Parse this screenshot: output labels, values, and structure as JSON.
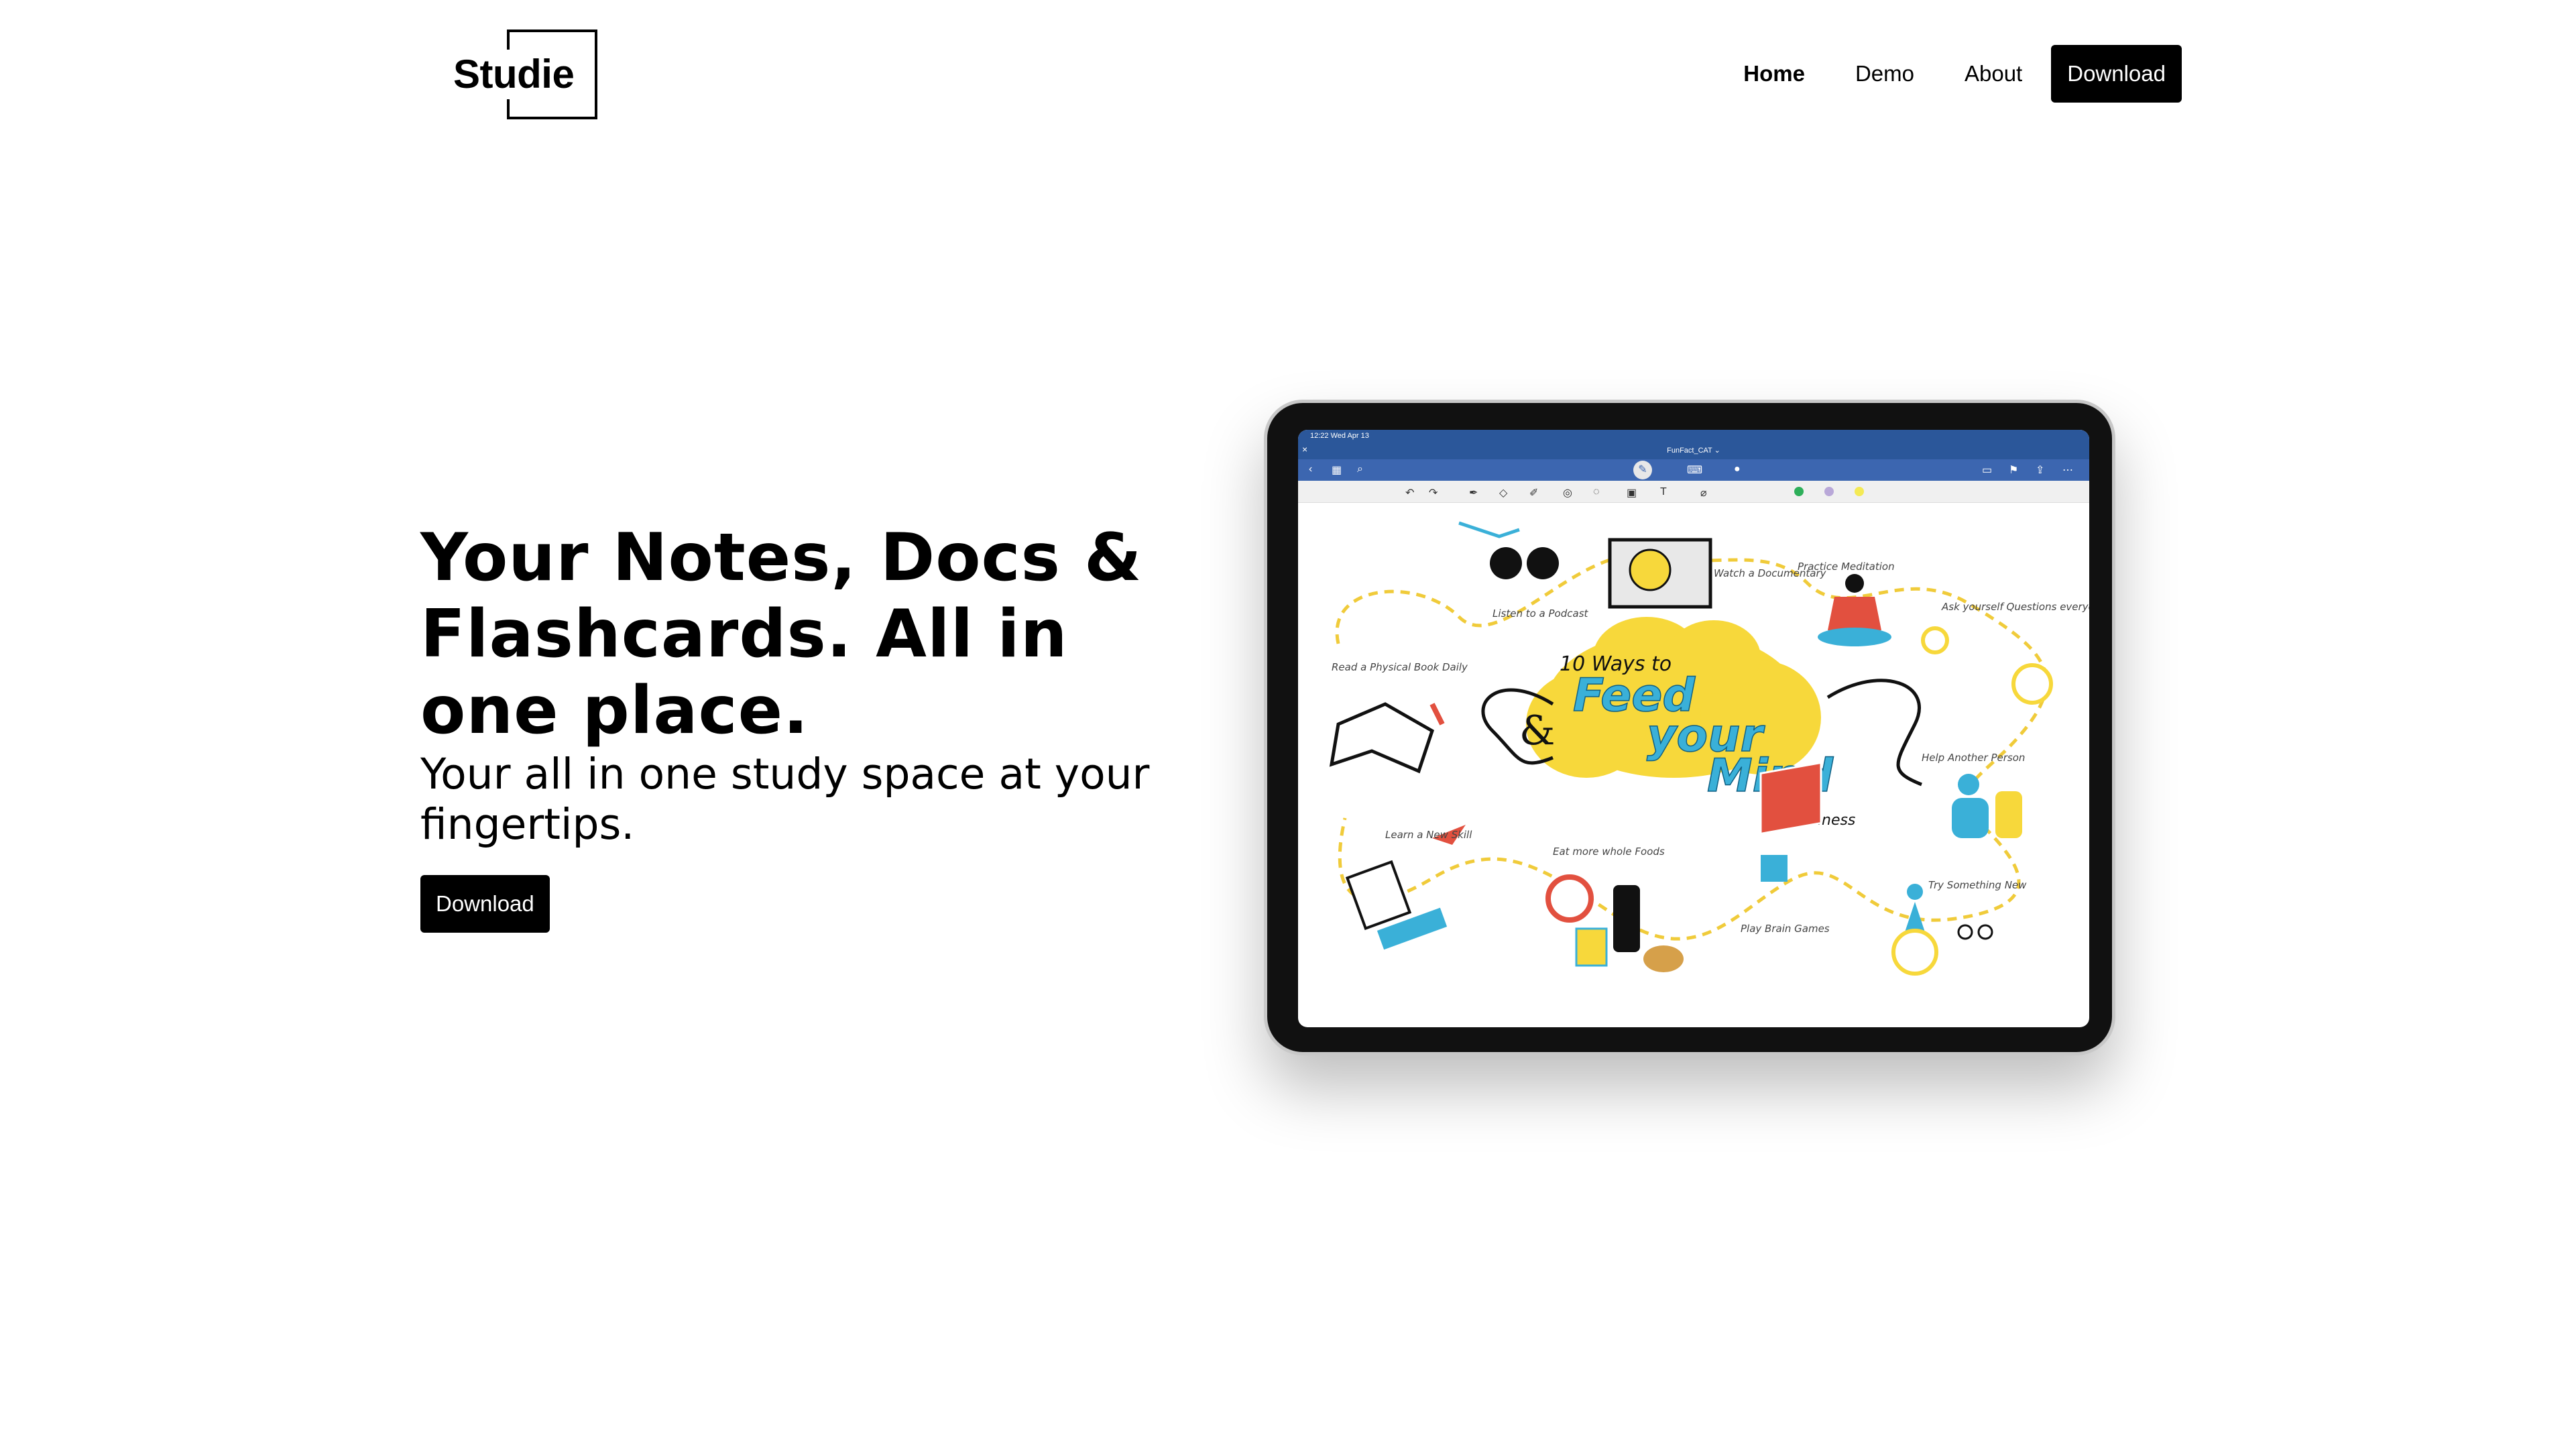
{
  "header": {
    "logo": "Studie",
    "nav": {
      "home": "Home",
      "demo": "Demo",
      "about": "About",
      "download": "Download"
    }
  },
  "hero": {
    "headline": "Your Notes, Docs & Flashcards. All in one place.",
    "subtitle": "Your all in one study space at your fingertips.",
    "cta": "Download"
  },
  "tablet": {
    "status_time": "12:22  Wed Apr 13",
    "doc_title": "FunFact_CAT ⌄",
    "poster": {
      "title_small": "10 Ways to",
      "title_feed": "Feed",
      "title_your": "your",
      "title_mind": "Mind",
      "title_sub": "for wellness",
      "amp": "&",
      "items": [
        "Listen to a Podcast",
        "Watch a Documentary",
        "Practice Meditation",
        "Ask yourself Questions everyday",
        "Read a Physical Book Daily",
        "Help Another Person",
        "Learn a New Skill",
        "Eat more whole Foods",
        "Play Brain Games",
        "Try Something New"
      ]
    }
  },
  "colors": {
    "accent": "#000000",
    "word_blue": "#2b579a",
    "poster_yellow": "#f7d83b",
    "poster_cyan": "#3ab0d8"
  }
}
